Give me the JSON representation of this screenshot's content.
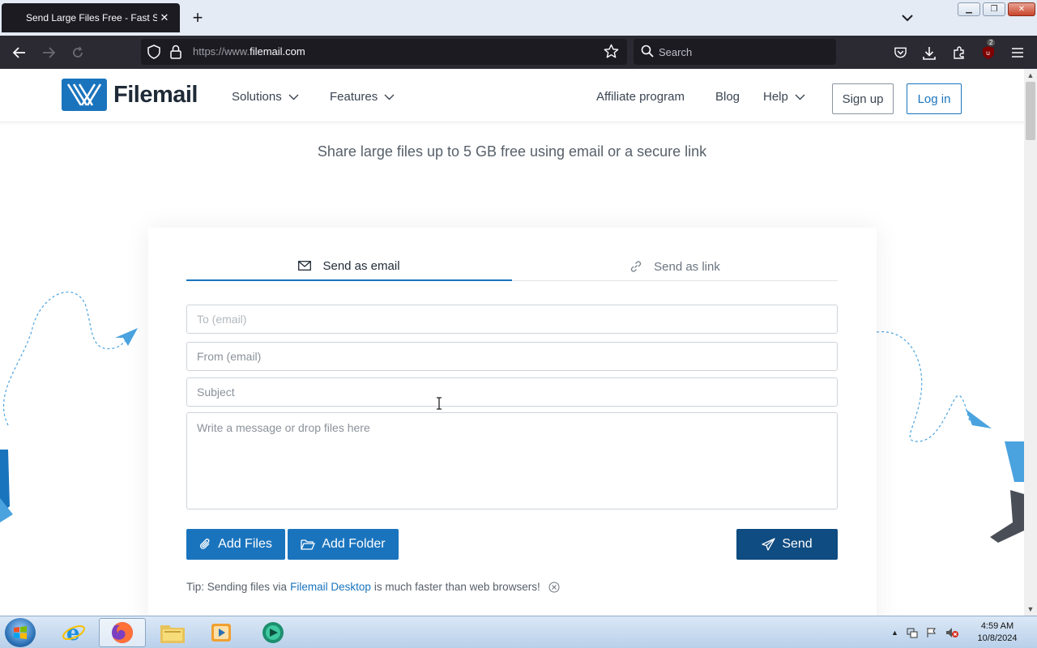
{
  "browser": {
    "tab_title": "Send Large Files Free - Fast Secure",
    "url_prefix": "https://www.",
    "url_domain": "filemail.com",
    "search_placeholder": "Search",
    "extension_badge": "2"
  },
  "site": {
    "logo_text": "Filemail",
    "nav": {
      "solutions": "Solutions",
      "features": "Features",
      "affiliate": "Affiliate program",
      "blog": "Blog",
      "help": "Help"
    },
    "signup_label": "Sign up",
    "login_label": "Log in",
    "hero_subtitle": "Share large files up to 5 GB free using email or a secure link",
    "colors": {
      "brand": "#1a74bd",
      "send": "#0f4c81"
    }
  },
  "form": {
    "tabs": {
      "email": "Send as email",
      "link": "Send as link"
    },
    "to_placeholder": "To (email)",
    "from_placeholder": "From (email)",
    "subject_placeholder": "Subject",
    "message_placeholder": "Write a message or drop files here",
    "add_files_label": "Add Files",
    "add_folder_label": "Add Folder",
    "send_label": "Send",
    "tip_prefix": "Tip: Sending files via",
    "tip_link": "Filemail Desktop",
    "tip_suffix": "is much faster than web browsers!"
  },
  "taskbar": {
    "time": "4:59 AM",
    "date": "10/8/2024",
    "apps": [
      "internet-explorer-icon",
      "firefox-icon",
      "file-explorer-icon",
      "media-player-icon",
      "app-icon"
    ]
  }
}
